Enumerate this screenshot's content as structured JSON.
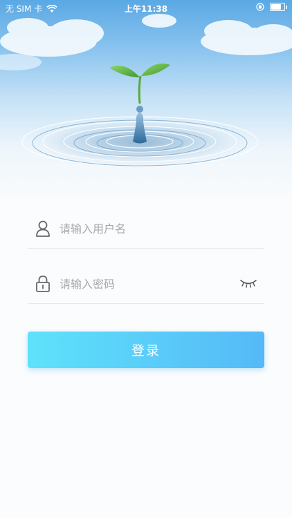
{
  "status_bar": {
    "carrier": "无 SIM 卡",
    "time": "上午11:38",
    "battery_level": 0.75,
    "icons": [
      "wifi-icon",
      "orientation-lock-icon",
      "battery-icon"
    ]
  },
  "hero": {
    "illustration": "sprout-water-drop"
  },
  "form": {
    "username_placeholder": "请输入用户名",
    "password_placeholder": "请输入密码",
    "username_icon": "user-icon",
    "password_icon": "lock-icon",
    "toggle_icon": "eye-closed-icon"
  },
  "login_button": {
    "label": "登录"
  },
  "colors": {
    "button_start": "#5ee2fb",
    "button_end": "#55b9f7",
    "placeholder": "#a8a8a8",
    "divider": "#e8e8e8"
  }
}
